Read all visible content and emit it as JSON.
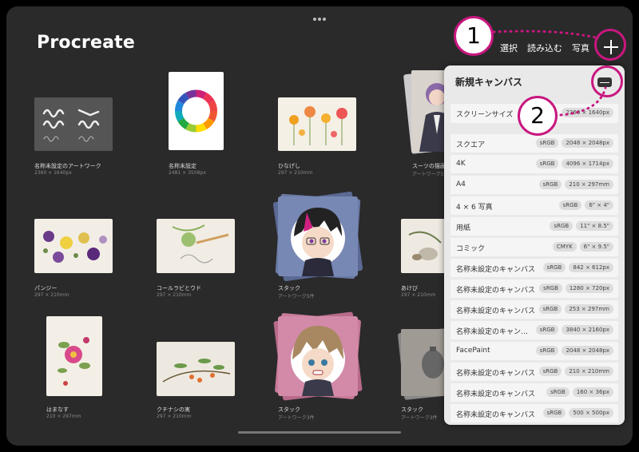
{
  "app": {
    "title": "Procreate"
  },
  "toolbar": {
    "select": "選択",
    "import": "読み込む",
    "photo": "写真"
  },
  "gallery": {
    "items": [
      {
        "name": "名称未設定のアートワーク",
        "size": "2360 × 1640px"
      },
      {
        "name": "名称未設定",
        "size": "2481 × 3508px"
      },
      {
        "name": "ひなげし",
        "size": "297 × 210mm"
      },
      {
        "name": "スーツの描画",
        "size": "アートワーク5"
      },
      {
        "name": "パンジー",
        "size": "297 × 210mm"
      },
      {
        "name": "コールラビとウド",
        "size": "297 × 210mm"
      },
      {
        "name": "スタック",
        "size": "アートワーク5件"
      },
      {
        "name": "あけび",
        "size": "297 × 210mm"
      },
      {
        "name": "はまなす",
        "size": "210 × 297mm"
      },
      {
        "name": "クチナシの実",
        "size": "297 × 210mm"
      },
      {
        "name": "スタック",
        "size": "アートワーク3件"
      },
      {
        "name": "スタック",
        "size": "アートワーク3件"
      }
    ]
  },
  "panel": {
    "title": "新規キャンバス",
    "screen": {
      "label": "スクリーンサイズ",
      "dims": "2360 × 1640px"
    },
    "rows": [
      {
        "label": "スクエア",
        "color": "sRGB",
        "dims": "2048 × 2048px"
      },
      {
        "label": "4K",
        "color": "sRGB",
        "dims": "4096 × 1714px"
      },
      {
        "label": "A4",
        "color": "sRGB",
        "dims": "210 × 297mm"
      },
      {
        "label": "4 × 6 写真",
        "color": "sRGB",
        "dims": "6\" × 4\""
      },
      {
        "label": "用紙",
        "color": "sRGB",
        "dims": "11\" × 8.5\""
      },
      {
        "label": "コミック",
        "color": "CMYK",
        "dims": "6\" × 9.5\""
      },
      {
        "label": "名称未設定のキャンバス",
        "color": "sRGB",
        "dims": "842 × 612px"
      },
      {
        "label": "名称未設定のキャンバス",
        "color": "sRGB",
        "dims": "1280 × 720px"
      },
      {
        "label": "名称未設定のキャンバス",
        "color": "sRGB",
        "dims": "253 × 297mm"
      },
      {
        "label": "名称未設定のキャン…",
        "color": "sRGB",
        "dims": "3840 × 2160px"
      },
      {
        "label": "FacePaint",
        "color": "sRGB",
        "dims": "2048 × 2048px"
      },
      {
        "label": "名称未設定のキャンバス",
        "color": "sRGB",
        "dims": "210 × 210mm"
      },
      {
        "label": "名称未設定のキャンバス",
        "color": "sRGB",
        "dims": "160 × 36px"
      },
      {
        "label": "名称未設定のキャンバス",
        "color": "sRGB",
        "dims": "500 × 500px"
      }
    ]
  },
  "annotations": {
    "one": "1",
    "two": "2"
  },
  "colors": {
    "annotation": "#c8177f",
    "background": "#2a2a2a"
  },
  "icons": {
    "plus": "plus-icon",
    "new-canvas": "new-canvas-icon",
    "more": "more-dots-icon"
  }
}
